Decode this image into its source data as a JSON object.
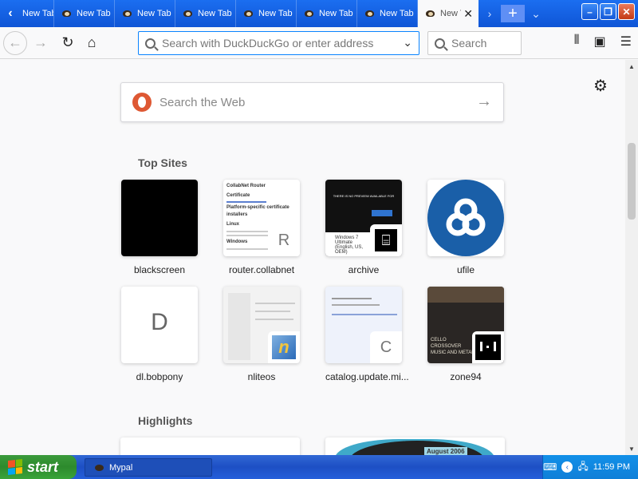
{
  "tabs": {
    "items": [
      {
        "label": "New Tab"
      },
      {
        "label": "New Tab"
      },
      {
        "label": "New Tab"
      },
      {
        "label": "New Tab"
      },
      {
        "label": "New Tab"
      },
      {
        "label": "New Tab"
      },
      {
        "label": "New Tab"
      }
    ],
    "active_label": "New Tab",
    "new_tab": "+"
  },
  "navbar": {
    "url_placeholder": "Search with DuckDuckGo or enter address",
    "search_placeholder": "Search"
  },
  "content": {
    "websearch_placeholder": "Search the Web",
    "top_sites_title": "Top Sites",
    "highlights_title": "Highlights",
    "top_sites": [
      {
        "label": "blackscreen"
      },
      {
        "label": "router.collabnet",
        "badge": "R"
      },
      {
        "label": "archive"
      },
      {
        "label": "ufile"
      },
      {
        "label": "dl.bobpony",
        "letter": "D"
      },
      {
        "label": "nliteos"
      },
      {
        "label": "catalog.update.mi...",
        "badge": "C"
      },
      {
        "label": "zone94"
      }
    ],
    "router_thumb": {
      "title": "CollabNet Router",
      "sub1": "Certificate",
      "sub2": "Platform-specific certificate installers",
      "sub3": "Linux",
      "sub4": "Windows"
    },
    "archive_thumb": {
      "line": "THERE IS NO PREVIEW AVAILABLE FOR",
      "line2": "Windows 7 Ultimate (English, US, OEM)"
    },
    "zone_thumb": {
      "line": "CELLO CROSSOVER MUSIC AND METAL"
    },
    "highlight_thumb": {
      "line": "August 2006"
    }
  },
  "taskbar": {
    "start_label": "start",
    "task_label": "Mypal",
    "clock": "11:59 PM"
  }
}
